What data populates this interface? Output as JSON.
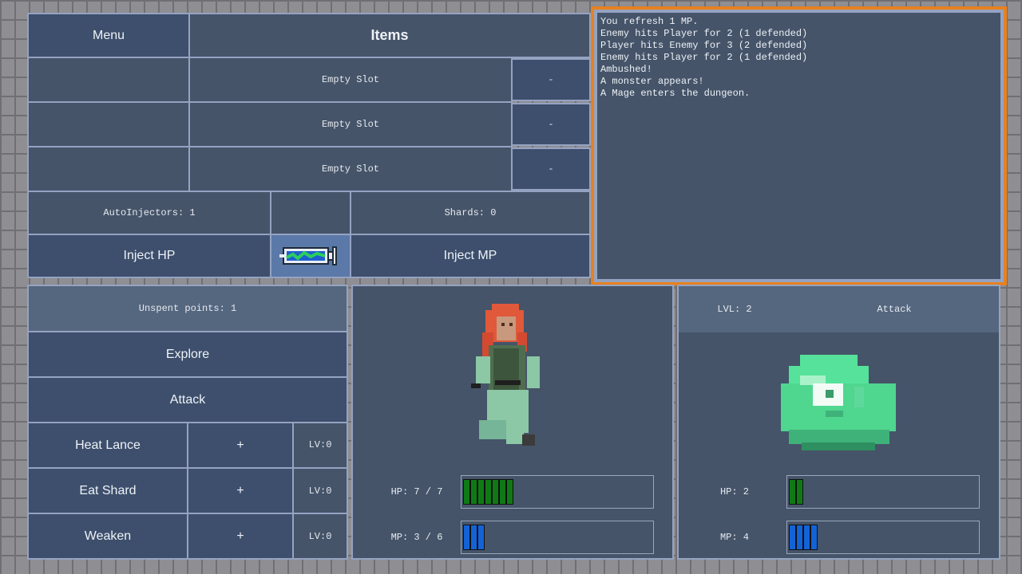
{
  "items_panel": {
    "menu_label": "Menu",
    "title": "Items",
    "slots": [
      {
        "name": "Empty Slot",
        "action": "-"
      },
      {
        "name": "Empty Slot",
        "action": "-"
      },
      {
        "name": "Empty Slot",
        "action": "-"
      }
    ],
    "autoinjectors": "AutoInjectors: 1",
    "shards": "Shards: 0",
    "inject_hp": "Inject HP",
    "inject_mp": "Inject MP"
  },
  "log": {
    "lines": [
      "You refresh 1 MP.",
      "Enemy hits Player for 2 (1 defended)",
      "Player hits Enemy for 3 (2 defended)",
      "Enemy hits Player for 2 (1 defended)",
      "Ambushed!",
      "A monster appears!",
      "A Mage enters the dungeon."
    ]
  },
  "actions": {
    "unspent_points": "Unspent points: 1",
    "explore": "Explore",
    "attack": "Attack",
    "skills": [
      {
        "name": "Heat Lance",
        "plus": "+",
        "level": "LV:0"
      },
      {
        "name": "Eat Shard",
        "plus": "+",
        "level": "LV:0"
      },
      {
        "name": "Weaken",
        "plus": "+",
        "level": "LV:0"
      }
    ]
  },
  "player": {
    "hp_label": "HP: 7 / 7",
    "mp_label": "MP: 3 / 6",
    "hp": 7,
    "hp_max": 7,
    "mp": 3,
    "mp_max": 6
  },
  "enemy": {
    "level": "LVL: 2",
    "intent": "Attack",
    "hp_label": "HP: 2",
    "mp_label": "MP: 4",
    "hp": 2,
    "mp": 4
  },
  "colors": {
    "hp": "#0f7a15",
    "mp": "#1463d6",
    "log_border": "#e8811e"
  }
}
